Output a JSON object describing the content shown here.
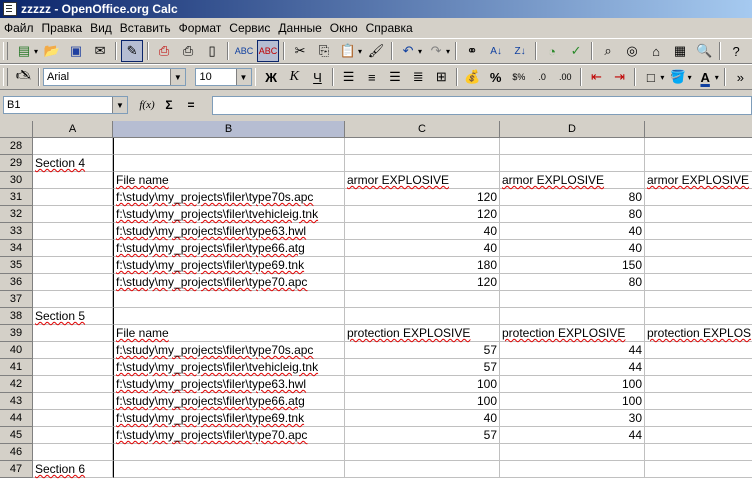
{
  "window": {
    "title": "zzzzz - OpenOffice.org Calc"
  },
  "menu": [
    "Файл",
    "Правка",
    "Вид",
    "Вставить",
    "Формат",
    "Сервис",
    "Данные",
    "Окно",
    "Справка"
  ],
  "format_bar": {
    "font_name": "Arial",
    "font_size": "10",
    "bold": "Ж",
    "italic": "К",
    "underline": "Ч"
  },
  "formula_bar": {
    "name_box": "B1",
    "fx": "f(x)",
    "sum": "Σ",
    "equals": "=",
    "content": ""
  },
  "columns": [
    "A",
    "B",
    "C",
    "D"
  ],
  "rows": [
    {
      "n": "28",
      "a": "",
      "b": "",
      "c": "",
      "d": "",
      "e": ""
    },
    {
      "n": "29",
      "a": "Section 4",
      "b": "",
      "c": "",
      "d": "",
      "e": ""
    },
    {
      "n": "30",
      "a": "",
      "b": "File name",
      "c": "armor EXPLOSIVE",
      "d": "armor EXPLOSIVE",
      "e": "armor EXPLOSIVE"
    },
    {
      "n": "31",
      "a": "",
      "b": "f:\\study\\my_projects\\filer\\type70s.apc",
      "c": "120",
      "d": "80",
      "e": ""
    },
    {
      "n": "32",
      "a": "",
      "b": "f:\\study\\my_projects\\filer\\tvehicleig.tnk",
      "c": "120",
      "d": "80",
      "e": ""
    },
    {
      "n": "33",
      "a": "",
      "b": "f:\\study\\my_projects\\filer\\type63.hwl",
      "c": "40",
      "d": "40",
      "e": ""
    },
    {
      "n": "34",
      "a": "",
      "b": "f:\\study\\my_projects\\filer\\type66.atg",
      "c": "40",
      "d": "40",
      "e": ""
    },
    {
      "n": "35",
      "a": "",
      "b": "f:\\study\\my_projects\\filer\\type69.tnk",
      "c": "180",
      "d": "150",
      "e": ""
    },
    {
      "n": "36",
      "a": "",
      "b": "f:\\study\\my_projects\\filer\\type70.apc",
      "c": "120",
      "d": "80",
      "e": ""
    },
    {
      "n": "37",
      "a": "",
      "b": "",
      "c": "",
      "d": "",
      "e": ""
    },
    {
      "n": "38",
      "a": "Section 5",
      "b": "",
      "c": "",
      "d": "",
      "e": ""
    },
    {
      "n": "39",
      "a": "",
      "b": "File name",
      "c": "protection EXPLOSIVE",
      "d": "protection EXPLOSIVE",
      "e": "protection EXPLOS"
    },
    {
      "n": "40",
      "a": "",
      "b": "f:\\study\\my_projects\\filer\\type70s.apc",
      "c": "57",
      "d": "44",
      "e": ""
    },
    {
      "n": "41",
      "a": "",
      "b": "f:\\study\\my_projects\\filer\\tvehicleig.tnk",
      "c": "57",
      "d": "44",
      "e": ""
    },
    {
      "n": "42",
      "a": "",
      "b": "f:\\study\\my_projects\\filer\\type63.hwl",
      "c": "100",
      "d": "100",
      "e": ""
    },
    {
      "n": "43",
      "a": "",
      "b": "f:\\study\\my_projects\\filer\\type66.atg",
      "c": "100",
      "d": "100",
      "e": ""
    },
    {
      "n": "44",
      "a": "",
      "b": "f:\\study\\my_projects\\filer\\type69.tnk",
      "c": "40",
      "d": "30",
      "e": ""
    },
    {
      "n": "45",
      "a": "",
      "b": "f:\\study\\my_projects\\filer\\type70.apc",
      "c": "57",
      "d": "44",
      "e": ""
    },
    {
      "n": "46",
      "a": "",
      "b": "",
      "c": "",
      "d": "",
      "e": ""
    },
    {
      "n": "47",
      "a": "Section 6",
      "b": "",
      "c": "",
      "d": "",
      "e": ""
    }
  ]
}
